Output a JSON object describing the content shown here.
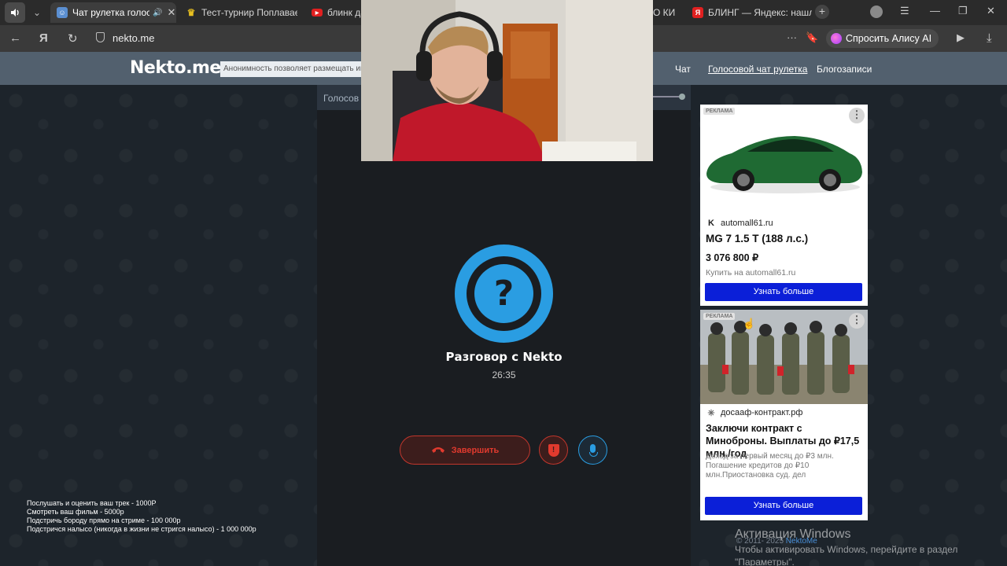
{
  "browser": {
    "tabs": [
      {
        "title": "Чат рулетка голосо",
        "favicon_color": "#5b8fd1",
        "active": true
      },
      {
        "title": "Тест-турнир Поплаваеш",
        "favicon_color": "#e8c020"
      },
      {
        "title": "блинк да",
        "favicon_color": "#e02020"
      },
      {
        "title": "О КИ",
        "favicon_color": "#444444"
      },
      {
        "title": "БЛИНГ — Яндекс: нашло",
        "favicon_color": "#e02020",
        "favicon_letter": "Я"
      }
    ],
    "address": "nekto.me",
    "alice_label": "Спросить Алису AI"
  },
  "site": {
    "logo": "Nekto.me",
    "promo": "Анонимность позволяет размещать инф",
    "nav": [
      {
        "label": "Чат"
      },
      {
        "label": "Голосовой чат рулетка",
        "underlined": true
      },
      {
        "label": "Блогозаписи"
      }
    ]
  },
  "call": {
    "header": "Голосов",
    "title": "Разговор с Nekto",
    "timer": "26:35",
    "end_label": "Завершить",
    "question_mark": "?"
  },
  "ads": [
    {
      "label": "РЕКЛАМА",
      "domain": "automall61.ru",
      "domain_icon": "K",
      "headline": "MG 7 1.5 T (188 л.с.)",
      "price": "3 076 800 ₽",
      "desc": "Купить на automall61.ru",
      "cta": "Узнать больше",
      "image_subject": "green-sedan"
    },
    {
      "label": "РЕКЛАМА",
      "domain": "досааф-контракт.рф",
      "headline": "Заключи контракт с Миноброны. Выплаты до ₽17,5 млн./год",
      "desc": "Доход за первый месяц до ₽3 млн. Погашение кредитов до ₽10 млн.Приостановка суд. дел",
      "cta": "Узнать больше",
      "image_subject": "soldiers-group"
    }
  ],
  "stream_overlay": [
    "Послушать и оценить ваш трек - 1000Р",
    "Смотреть ваш фильм - 5000р",
    "Подстричь бороду прямо на стриме - 100 000р",
    "Подстричся налысо (никогда в жизни не стригся налысо) - 1 000 000р"
  ],
  "windows_activation": {
    "title": "Активация Windows",
    "subtitle": "Чтобы активировать Windows, перейдите в раздел",
    "subtitle2": "\"Параметры\"."
  },
  "footer": {
    "copyright": "© 2011- 2025",
    "link": "NektoMe"
  }
}
